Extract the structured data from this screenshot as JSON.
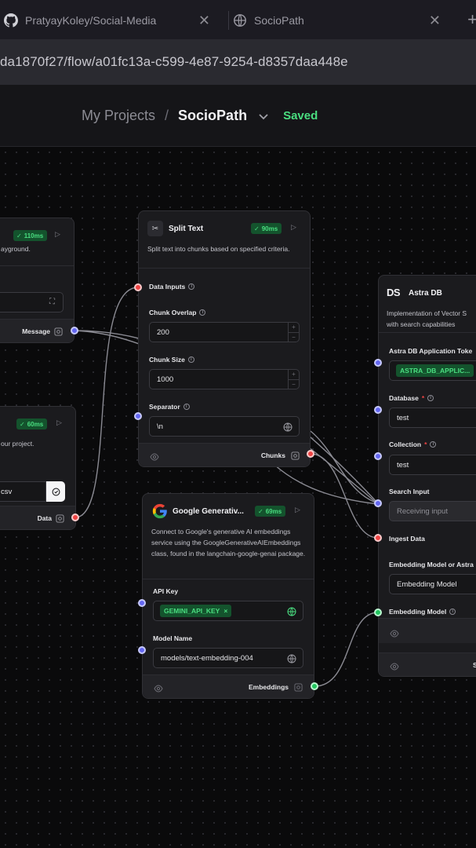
{
  "browser": {
    "tabs": [
      {
        "title": "PratyayKoley/Social-Media",
        "icon": "github-icon"
      },
      {
        "title": "SocioPath",
        "icon": "globe-icon"
      }
    ],
    "url": "da1870f27/flow/a01fc13a-c599-4e87-9254-d8357daa448e"
  },
  "header": {
    "crumb_root": "My Projects",
    "crumb_sep": "/",
    "crumb_current": "SocioPath",
    "status": "Saved"
  },
  "nodes": {
    "chat_input": {
      "badge": "110ms",
      "desc": "ayground.",
      "output_label": "Message"
    },
    "file": {
      "badge": "60ms",
      "desc": "our project.",
      "file_value": "csv",
      "output_label": "Data"
    },
    "split_text": {
      "title": "Split Text",
      "badge": "90ms",
      "desc": "Split text into chunks based on specified criteria.",
      "data_inputs_label": "Data Inputs",
      "chunk_overlap_label": "Chunk Overlap",
      "chunk_overlap_value": "200",
      "chunk_size_label": "Chunk Size",
      "chunk_size_value": "1000",
      "separator_label": "Separator",
      "separator_value": "\\n",
      "output_label": "Chunks"
    },
    "google": {
      "title": "Google Generativ...",
      "badge": "69ms",
      "desc": "Connect to Google's generative AI embeddings service using the GoogleGenerativeAIEmbeddings class, found in the langchain-google-genai package.",
      "api_key_label": "API Key",
      "api_key_value": "GEMINI_API_KEY",
      "model_name_label": "Model Name",
      "model_name_value": "models/text-embedding-004",
      "output_label": "Embeddings"
    },
    "astra": {
      "title": "Astra DB",
      "logo": "DS",
      "desc_line1": "Implementation of Vector S",
      "desc_line2": "with search capabilities",
      "token_label": "Astra DB Application Toke",
      "token_value": "ASTRA_DB_APPLIC...",
      "database_label": "Database",
      "database_value": "test",
      "collection_label": "Collection",
      "collection_value": "test",
      "search_input_label": "Search Input",
      "search_input_placeholder": "Receiving input",
      "ingest_label": "Ingest Data",
      "embedding_choice_label": "Embedding Model or Astra",
      "embedding_choice_value": "Embedding Model",
      "embedding_model_label": "Embedding Model",
      "footer_label": "S"
    }
  },
  "colors": {
    "handle_blue": "#6366f1",
    "handle_red": "#ef4444",
    "handle_green": "#22c55e",
    "badge_green": "#4ade80",
    "saved_green": "#4ade80"
  }
}
